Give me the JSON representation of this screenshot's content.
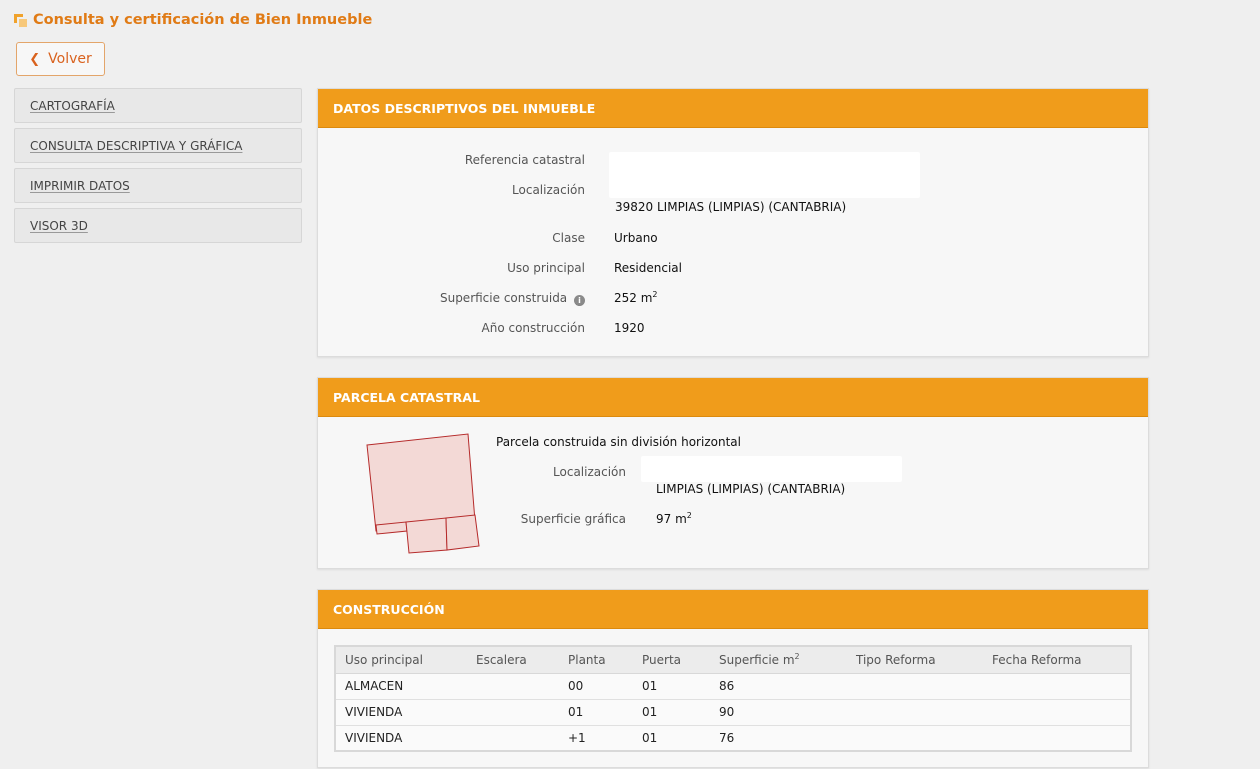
{
  "page": {
    "title": "Consulta y certificación de Bien Inmueble",
    "back_label": "Volver"
  },
  "sidebar": {
    "items": [
      {
        "label": "CARTOGRAFÍA"
      },
      {
        "label": "CONSULTA DESCRIPTIVA Y GRÁFICA"
      },
      {
        "label": "IMPRIMIR DATOS"
      },
      {
        "label": "VISOR 3D"
      }
    ]
  },
  "datos": {
    "heading": "DATOS DESCRIPTIVOS DEL INMUEBLE",
    "ref_label": "Referencia catastral",
    "loc_label": "Localización",
    "loc_value": "39820 LIMPIAS (LIMPIAS) (CANTABRIA)",
    "clase_label": "Clase",
    "clase_value": "Urbano",
    "uso_label": "Uso principal",
    "uso_value": "Residencial",
    "sup_label": "Superficie construida",
    "sup_value": "252 m",
    "sup_unit_sup": "2",
    "anio_label": "Año construcción",
    "anio_value": "1920"
  },
  "parcela": {
    "heading": "PARCELA CATASTRAL",
    "description": "Parcela construida sin división horizontal",
    "loc_label": "Localización",
    "loc_value": "LIMPIAS (LIMPIAS) (CANTABRIA)",
    "sup_label": "Superficie gráfica",
    "sup_value": "97 m",
    "sup_unit_sup": "2"
  },
  "construccion": {
    "heading": "CONSTRUCCIÓN",
    "columns": [
      "Uso principal",
      "Escalera",
      "Planta",
      "Puerta",
      "Superficie m",
      "Tipo Reforma",
      "Fecha Reforma"
    ],
    "sup_col_sup": "2",
    "rows": [
      [
        "ALMACEN",
        "",
        "00",
        "01",
        "86",
        "",
        ""
      ],
      [
        "VIVIENDA",
        "",
        "01",
        "01",
        "90",
        "",
        ""
      ],
      [
        "VIVIENDA",
        "",
        "+1",
        "01",
        "76",
        "",
        ""
      ]
    ]
  },
  "colors": {
    "accent": "#f09c1b",
    "title": "#e07b16",
    "parcel_fill": "#f3d9d6",
    "parcel_stroke": "#b52a2a"
  }
}
